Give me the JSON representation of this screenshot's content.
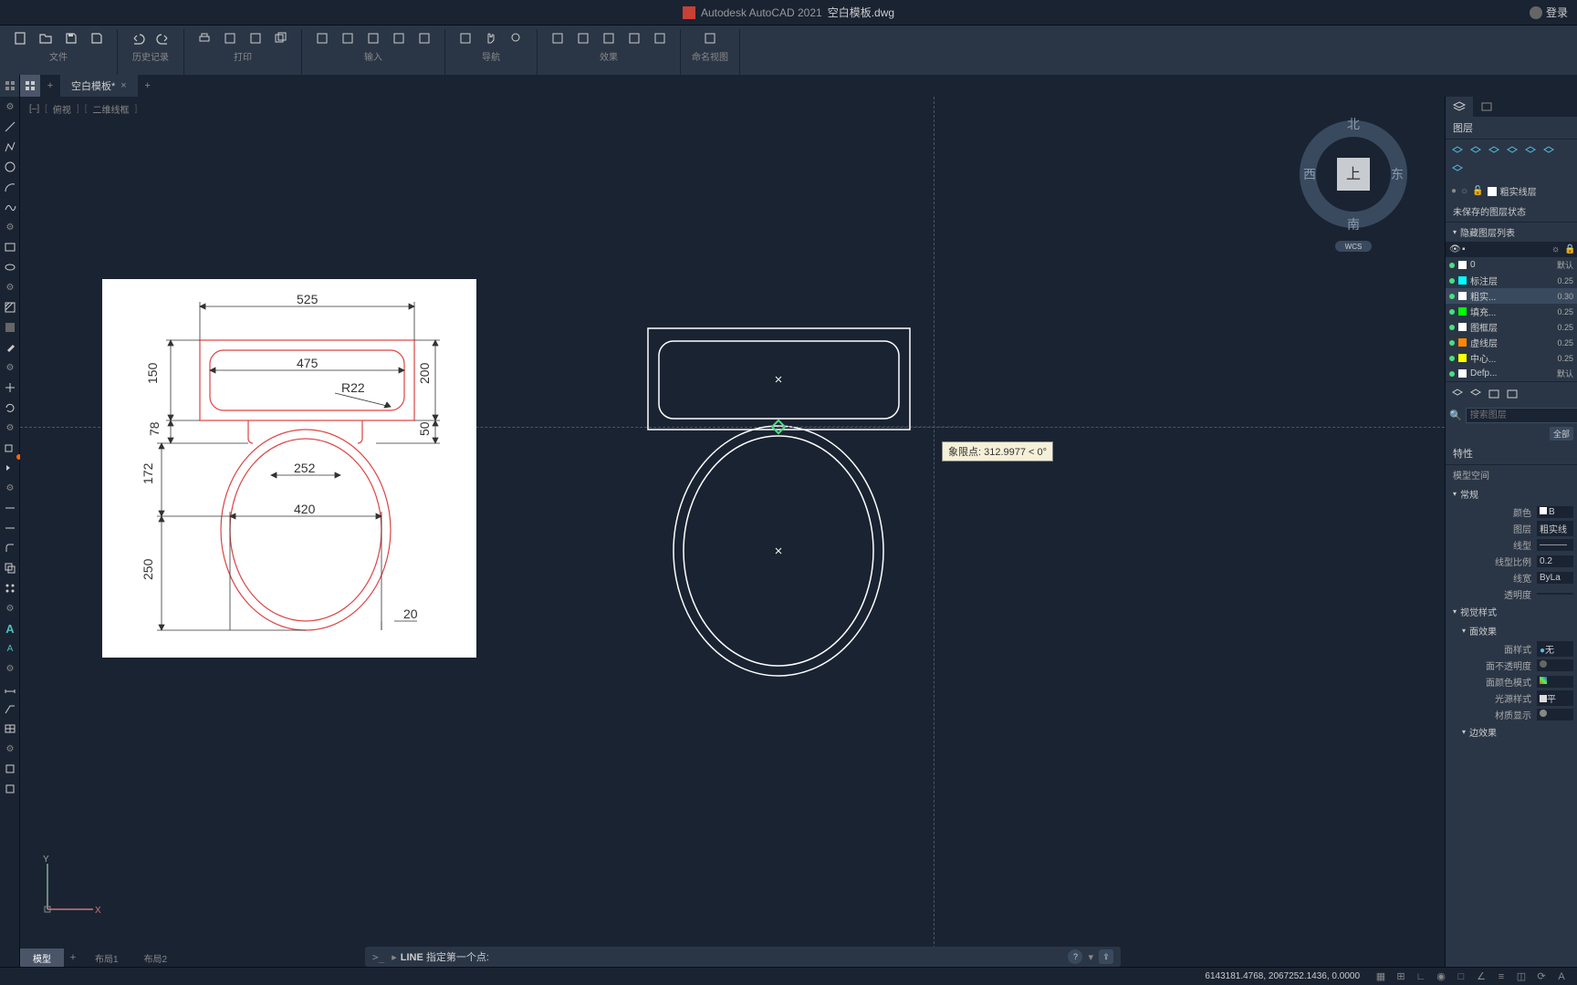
{
  "titlebar": {
    "app_name": "Autodesk AutoCAD 2021",
    "file_name": "空白模板.dwg",
    "login": "登录"
  },
  "ribbon": {
    "groups": [
      {
        "label": "文件",
        "icons": [
          "new",
          "open",
          "save",
          "saveas"
        ]
      },
      {
        "label": "历史记录",
        "icons": [
          "undo",
          "redo"
        ]
      },
      {
        "label": "打印",
        "icons": [
          "print",
          "preview",
          "plot",
          "batch"
        ]
      },
      {
        "label": "输入",
        "icons": [
          "import1",
          "import2",
          "import3",
          "import4",
          "import5"
        ]
      },
      {
        "label": "导航",
        "icons": [
          "pan",
          "orbit",
          "zoom"
        ]
      },
      {
        "label": "效果",
        "icons": [
          "fx1",
          "fx2",
          "fx3",
          "fx4",
          "fx5"
        ]
      },
      {
        "label": "命名视图",
        "icons": [
          "view"
        ]
      }
    ]
  },
  "tab": {
    "name": "空白模板*"
  },
  "viewport": {
    "mode1": "俯视",
    "mode2": "二维线框"
  },
  "viewcube": {
    "n": "北",
    "s": "南",
    "e": "东",
    "w": "西",
    "top": "上",
    "wcs": "WCS"
  },
  "reference_drawing": {
    "dims": {
      "d525": "525",
      "d475": "475",
      "r22": "R22",
      "d150": "150",
      "d200": "200",
      "d78": "78",
      "d50": "50",
      "d172": "172",
      "d252": "252",
      "d420": "420",
      "d250": "250",
      "d20": "20"
    }
  },
  "tooltip": {
    "label": "象限点:",
    "value": "312.9977 < 0°"
  },
  "cmdline": {
    "cmd": "LINE",
    "prompt": "指定第一个点:"
  },
  "modeltabs": {
    "model": "模型",
    "layout1": "布局1",
    "layout2": "布局2"
  },
  "status": {
    "coords": "6143181.4768, 2067252.1436, 0.0000"
  },
  "layers_panel": {
    "title": "图层",
    "current_layer": "粗实线层",
    "unsaved_state": "未保存的图层状态",
    "hide_list": "隐藏图层列表",
    "search_placeholder": "搜索图层",
    "all": "全部",
    "header_default": "默认",
    "layers": [
      {
        "name": "0",
        "color": "#ffffff",
        "lw": "默认"
      },
      {
        "name": "标注层",
        "color": "#00ffff",
        "lw": "0.25"
      },
      {
        "name": "粗实...",
        "color": "#ffffff",
        "lw": "0.30"
      },
      {
        "name": "填充...",
        "color": "#00ff00",
        "lw": "0.25"
      },
      {
        "name": "图框层",
        "color": "#ffffff",
        "lw": "0.25"
      },
      {
        "name": "虚线层",
        "color": "#ff8800",
        "lw": "0.25"
      },
      {
        "name": "中心...",
        "color": "#ffff00",
        "lw": "0.25"
      },
      {
        "name": "Defp...",
        "color": "#ffffff",
        "lw": "默认"
      }
    ]
  },
  "properties_panel": {
    "title": "特性",
    "space": "模型空间",
    "general": "常规",
    "color_label": "颜色",
    "color_val": "B",
    "layer_label": "图层",
    "layer_val": "粗实线",
    "ltype_label": "线型",
    "ltype_val": "",
    "ltscale_label": "线型比例",
    "ltscale_val": "0.2",
    "lweight_label": "线宽",
    "lweight_val": "ByLa",
    "transp_label": "透明度",
    "transp_val": "",
    "visual_style": "视觉样式",
    "face_effect": "面效果",
    "face_style_label": "面样式",
    "face_style_val": "无",
    "face_opacity_label": "面不透明度",
    "face_color_label": "面颜色模式",
    "light_style_label": "光源样式",
    "light_style_val": "平",
    "mat_display_label": "材质显示",
    "edge_effect": "边效果"
  },
  "colors": {
    "bg": "#1a2332",
    "panel": "#2a3646",
    "accent": "#4ade80",
    "tooltip_bg": "#f5f0d8"
  }
}
